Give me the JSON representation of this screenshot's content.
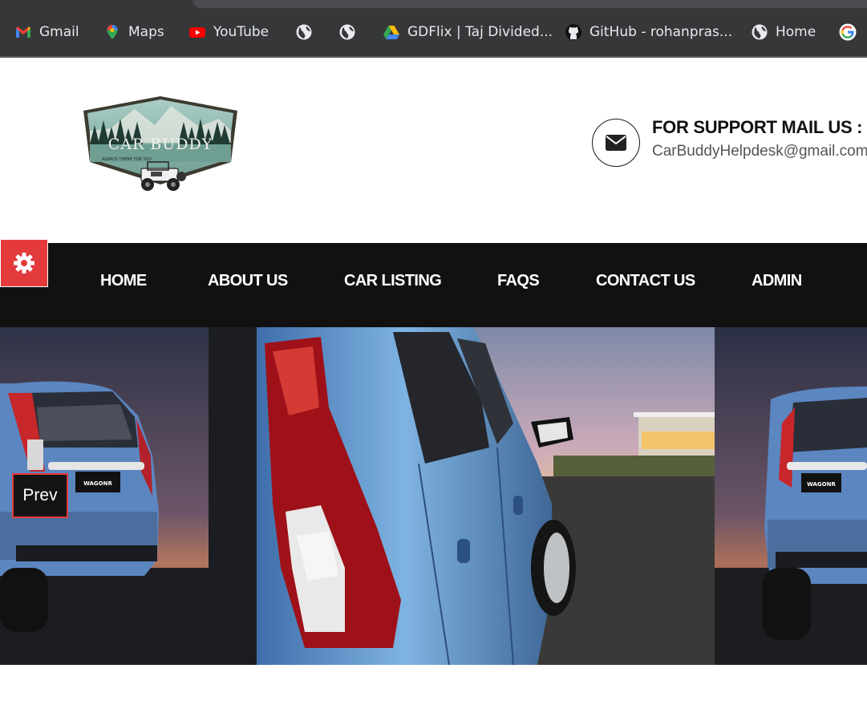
{
  "bookmarks": [
    {
      "label": "Gmail",
      "icon": "gmail-icon"
    },
    {
      "label": "Maps",
      "icon": "maps-icon"
    },
    {
      "label": "YouTube",
      "icon": "youtube-icon"
    },
    {
      "label": "",
      "icon": "globe-icon"
    },
    {
      "label": "",
      "icon": "globe-icon"
    },
    {
      "label": "GDFlix | Taj Divided...",
      "icon": "drive-icon"
    },
    {
      "label": "GitHub - rohanpras...",
      "icon": "github-icon"
    },
    {
      "label": "Home",
      "icon": "globe-icon"
    },
    {
      "label": "",
      "icon": "google-icon"
    }
  ],
  "header": {
    "logo": {
      "title": "CAR BUDDY",
      "tagline": "ALWAYS THERE FOR YOU"
    },
    "support_title": "FOR SUPPORT MAIL US :",
    "support_email": "CarBuddyHelpdesk@gmail.com",
    "support_icon": "envelope-icon"
  },
  "nav": {
    "items": [
      "HOME",
      "ABOUT US",
      "CAR LISTING",
      "FAQS",
      "CONTACT US",
      "ADMIN"
    ],
    "settings_icon": "gear-icon"
  },
  "slider": {
    "prev_label": "Prev",
    "badge_text": "WAGONR"
  },
  "colors": {
    "accent": "#e33b3b",
    "nav_bg": "#111111",
    "bookmarks_bg": "#353739"
  }
}
